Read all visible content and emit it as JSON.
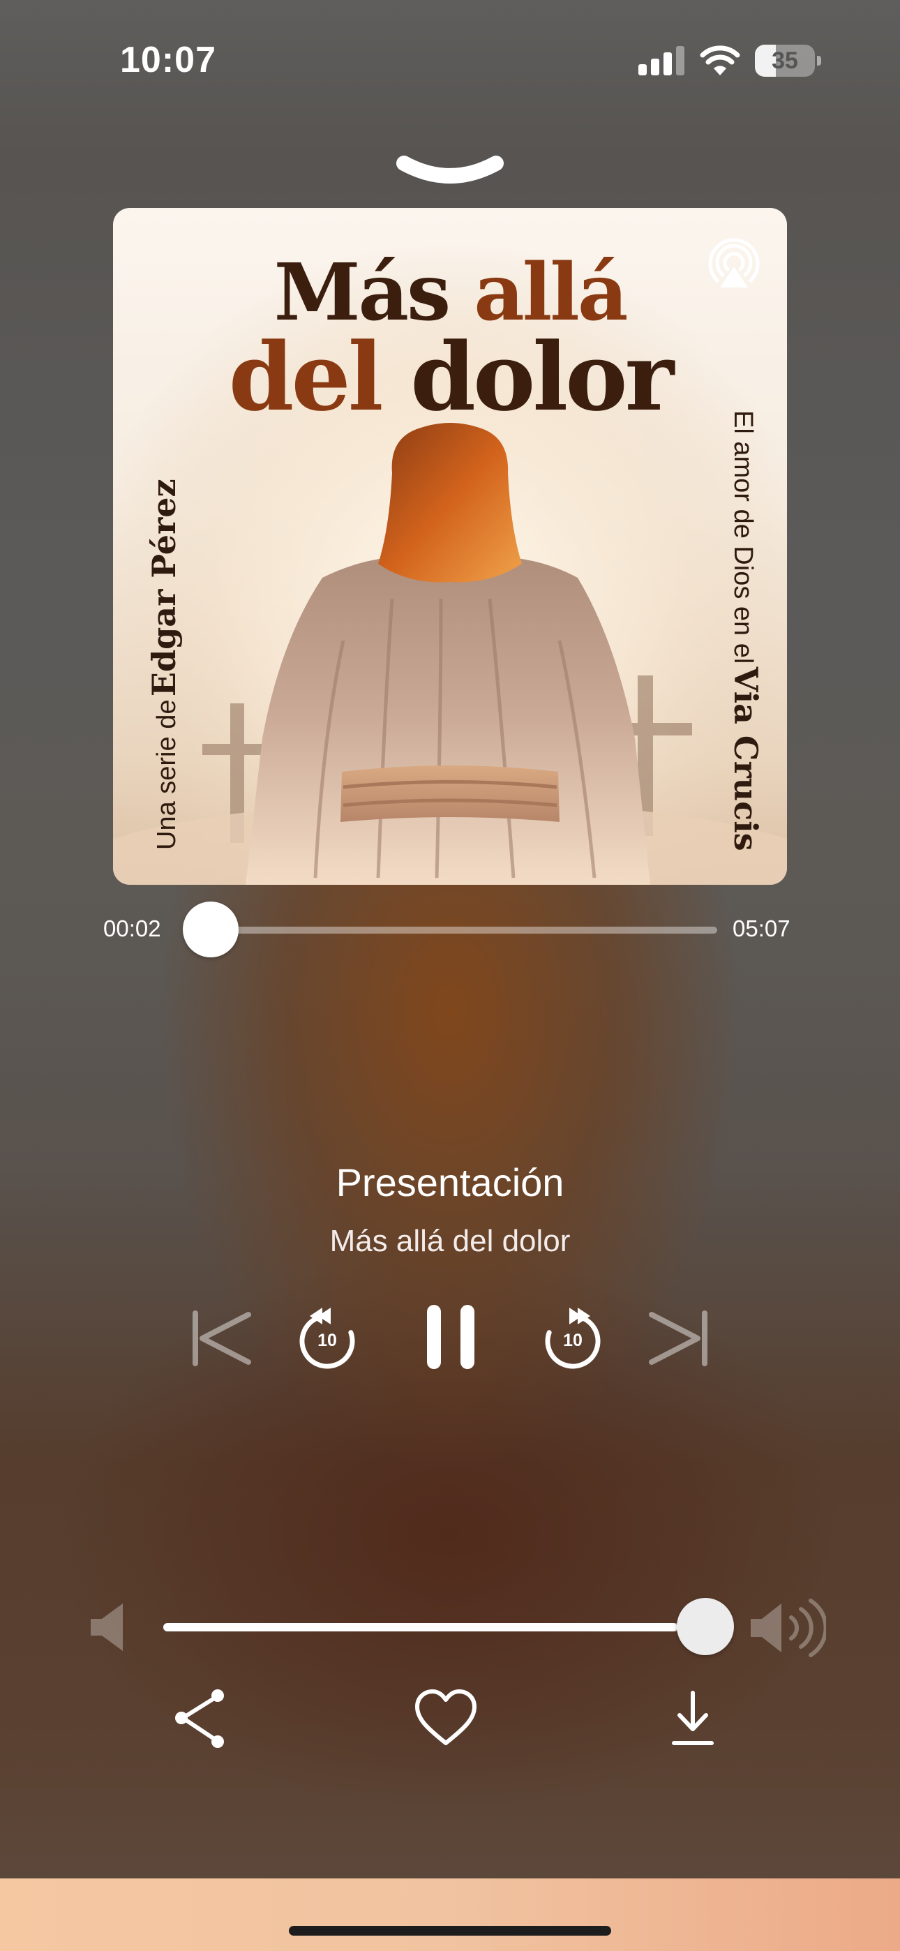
{
  "status_bar": {
    "time": "10:07",
    "battery_level": "35",
    "battery_fraction": 0.35,
    "icons": [
      "signal-icon",
      "wifi-icon",
      "battery-icon"
    ]
  },
  "artwork": {
    "title_line1_word1": "Más",
    "title_line1_word2": "allá",
    "title_line2_word1": "del",
    "title_line2_word2": "dolor",
    "left_credit_small": "Una serie de",
    "left_credit_big": "Edgar Pérez",
    "right_credit_small": "El amor de Dios en el",
    "right_credit_big": "Via Crucis",
    "badge_icon": "podcast-icon"
  },
  "progress": {
    "elapsed": "00:02",
    "total": "05:07",
    "fraction": 0.007
  },
  "track": {
    "title": "Presentación",
    "subtitle": "Más allá del dolor"
  },
  "controls": {
    "skip_back_seconds": "10",
    "skip_forward_seconds": "10",
    "state": "playing",
    "icons": [
      "previous-icon",
      "skip-back-10-icon",
      "pause-icon",
      "skip-forward-10-icon",
      "next-icon"
    ]
  },
  "volume": {
    "level": 0.95
  },
  "actions": {
    "icons": [
      "share-icon",
      "heart-icon",
      "download-icon"
    ]
  },
  "colors": {
    "title_dark": "#3b1e0e",
    "title_rust": "#8a3a12",
    "bottom_band": "#f1c3a0"
  }
}
